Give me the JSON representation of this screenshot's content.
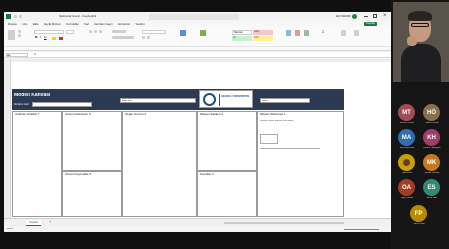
{
  "excel": {
    "title": "Şablonlar Excel - Kaydedildi",
    "user": "Elif DEMİR",
    "menu": [
      "Dosya",
      "Giriş",
      "Ekle",
      "Sayfa Düzeni",
      "Formüller",
      "Veri",
      "Gözden Geçir",
      "Görünüm",
      "Yardım"
    ],
    "menu_extra": "Paylaş",
    "styles": [
      "Normal",
      "Kötü",
      "İyi",
      "Nötr"
    ],
    "style_colors": [
      "#ffffff",
      "#f4c7ce",
      "#c6efce",
      "#ffeb9c"
    ],
    "name_box": "A1",
    "canvas": {
      "title": "Modeli Kanvası",
      "subtitle": "Girişim Adı:",
      "field_mid": "Ekip Adı:",
      "field_right": "Tarih:",
      "logo_text": "ANADOLU ÜNİVERSİTESİ",
      "cells": {
        "key_partners": "Anahtar Ortaklar 7",
        "key_activities": "Önemli Aktiviteler 6",
        "value_props": "Değer Önerisi 2",
        "customer_rel": "Müşteri İlişkileri 3",
        "segments": "Müşteri Bölümleri 1",
        "key_resources": "Önemli Kaynaklar 5",
        "channels": "Kanallar 4"
      },
      "segments_note": "Kullanıcı profili bilgilerini not ediniz."
    },
    "sheet_tab": "Sayfa1",
    "status": "Hazır"
  },
  "participants": [
    {
      "initials": "MT",
      "name": "Merve Tülüce",
      "color": "#a44b52"
    },
    {
      "initials": "HÖ",
      "name": "Hatice Özkan",
      "color": "#8a6f4a"
    },
    {
      "initials": "MA",
      "name": "Mehmet Aslan",
      "color": "#2f6fb1"
    },
    {
      "initials": "KH",
      "name": "Kerem Hatipoğlu",
      "color": "#a13b6a"
    },
    {
      "initials": "",
      "name": "Nazli Eren",
      "color": "#c8a000"
    },
    {
      "initials": "MK",
      "name": "Melike Karaca",
      "color": "#c57a1e"
    },
    {
      "initials": "",
      "name": "Ufuk Yiğit Akso",
      "color": "#7a2e36"
    },
    {
      "initials": "ES",
      "name": "Emre Sarı",
      "color": "#2f8a72"
    },
    {
      "initials": "OA",
      "name": "Oğuz Arslan",
      "color": "#a33d29"
    },
    {
      "initials": "",
      "name": "Zeynep Kılıç",
      "color": "#444444"
    },
    {
      "initials": "FP",
      "name": "Fatih Polat",
      "color": "#b58c00"
    }
  ]
}
